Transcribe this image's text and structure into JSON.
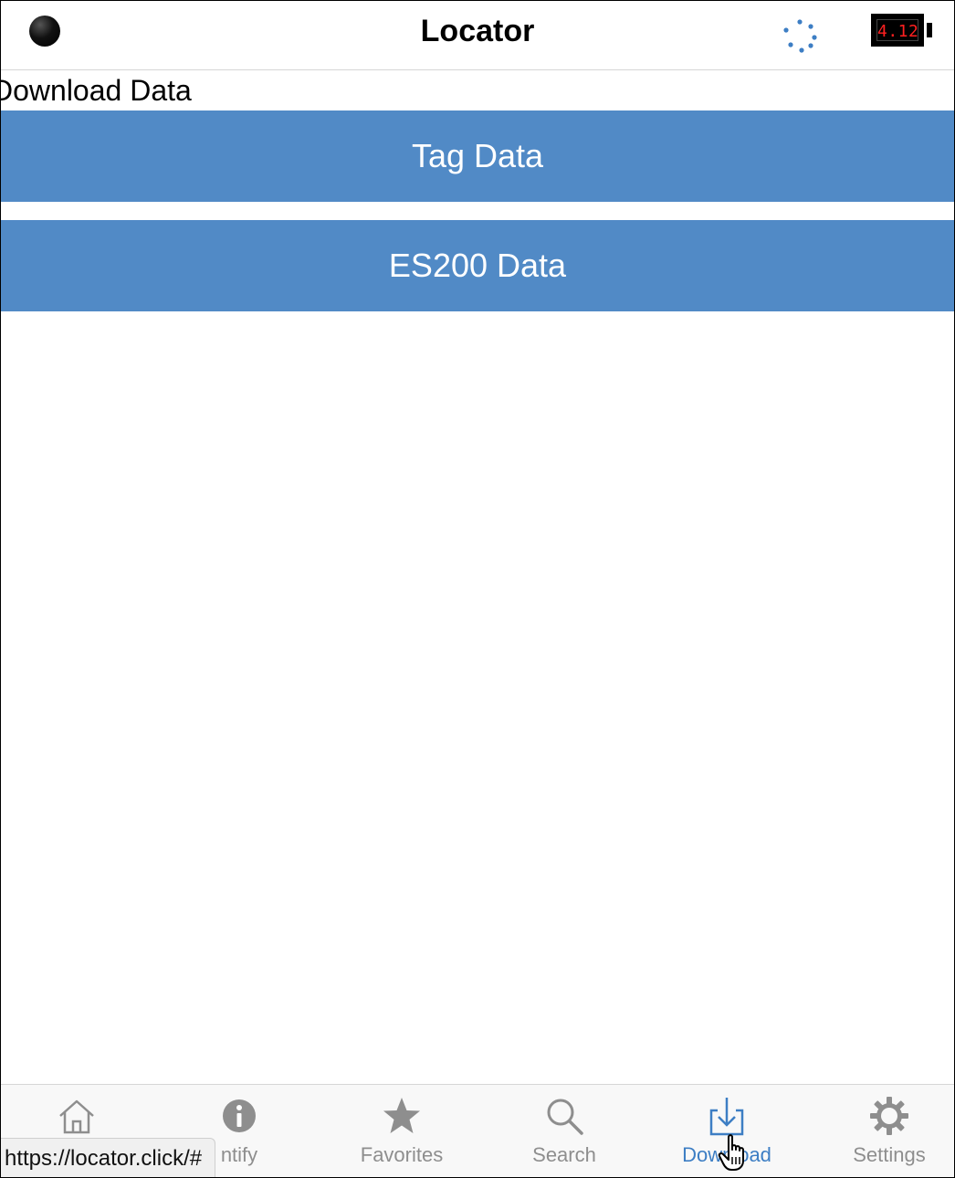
{
  "header": {
    "title": "Locator",
    "status_indicator": "connection-status-dot",
    "battery_value": "4.12",
    "battery_text_color": "#ff2020"
  },
  "page": {
    "heading": "Download Data"
  },
  "buttons": {
    "tag_data": "Tag Data",
    "es200_data": "ES200 Data",
    "button_color": "#518ac6"
  },
  "tabbar": {
    "active_color": "#3d7ec4",
    "inactive_color": "#8e8e8e",
    "tabs": [
      {
        "id": "home",
        "label": "",
        "icon": "home-icon"
      },
      {
        "id": "identify",
        "label": "ntify",
        "icon": "info-icon"
      },
      {
        "id": "favorites",
        "label": "Favorites",
        "icon": "star-icon"
      },
      {
        "id": "search",
        "label": "Search",
        "icon": "search-icon"
      },
      {
        "id": "download",
        "label": "Download",
        "icon": "download-icon",
        "active": true
      },
      {
        "id": "settings",
        "label": "Settings",
        "icon": "gear-icon"
      }
    ]
  },
  "status_bar": {
    "url": "https://locator.click/#"
  }
}
